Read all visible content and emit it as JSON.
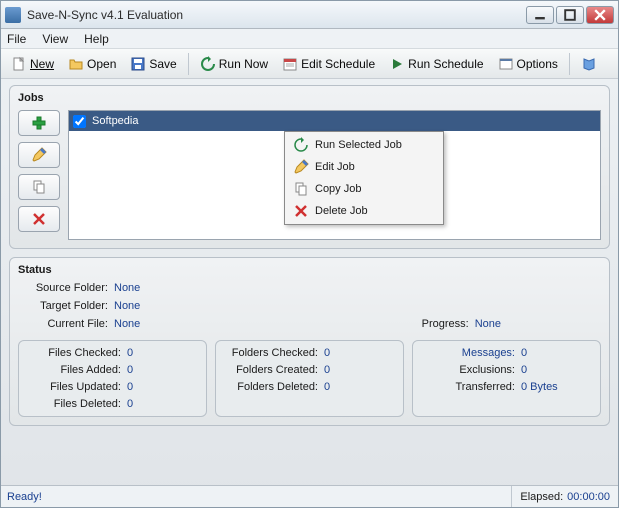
{
  "window": {
    "title": "Save-N-Sync v4.1 Evaluation"
  },
  "menubar": {
    "file": "File",
    "view": "View",
    "help": "Help"
  },
  "toolbar": {
    "new": "New",
    "open": "Open",
    "save": "Save",
    "run_now": "Run Now",
    "edit_schedule": "Edit Schedule",
    "run_schedule": "Run Schedule",
    "options": "Options"
  },
  "jobs": {
    "title": "Jobs",
    "items": [
      {
        "name": "Softpedia",
        "checked": true
      }
    ]
  },
  "context_menu": {
    "run_selected": "Run Selected Job",
    "edit_job": "Edit Job",
    "copy_job": "Copy Job",
    "delete_job": "Delete Job"
  },
  "status": {
    "title": "Status",
    "source_folder_label": "Source Folder:",
    "source_folder": "None",
    "target_folder_label": "Target Folder:",
    "target_folder": "None",
    "current_file_label": "Current File:",
    "current_file": "None",
    "progress_label": "Progress:",
    "progress": "None",
    "col1": {
      "files_checked_label": "Files Checked:",
      "files_checked": "0",
      "files_added_label": "Files Added:",
      "files_added": "0",
      "files_updated_label": "Files Updated:",
      "files_updated": "0",
      "files_deleted_label": "Files Deleted:",
      "files_deleted": "0"
    },
    "col2": {
      "folders_checked_label": "Folders Checked:",
      "folders_checked": "0",
      "folders_created_label": "Folders Created:",
      "folders_created": "0",
      "folders_deleted_label": "Folders Deleted:",
      "folders_deleted": "0"
    },
    "col3": {
      "messages_label": "Messages:",
      "messages": "0",
      "exclusions_label": "Exclusions:",
      "exclusions": "0",
      "transferred_label": "Transferred:",
      "transferred": "0 Bytes"
    }
  },
  "statusbar": {
    "ready": "Ready!",
    "elapsed_label": "Elapsed:",
    "elapsed": "00:00:00"
  }
}
